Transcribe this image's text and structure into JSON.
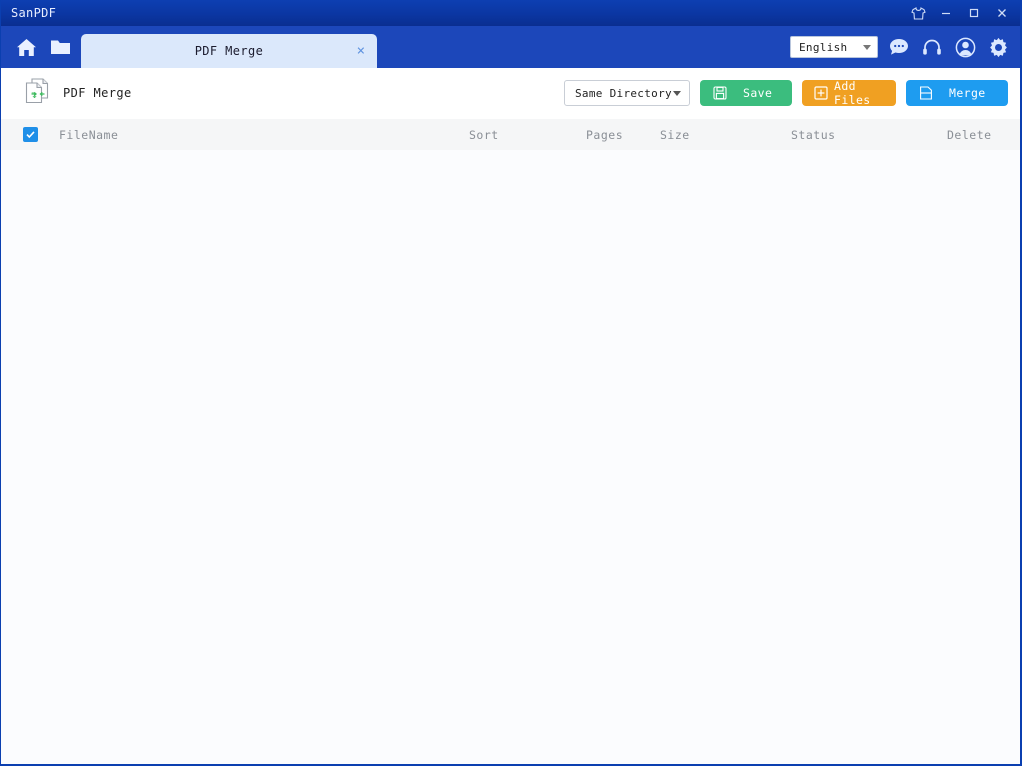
{
  "window": {
    "app_title": "SanPDF",
    "controls": [
      {
        "name": "skin-icon",
        "label": "Skin"
      },
      {
        "name": "minimize-button",
        "label": "Minimize"
      },
      {
        "name": "maximize-button",
        "label": "Maximize"
      },
      {
        "name": "close-button",
        "label": "Close"
      }
    ]
  },
  "tab_bar": {
    "nav_icons": [
      {
        "name": "home-icon",
        "label": "Home"
      },
      {
        "name": "open-folder-icon",
        "label": "Open Folder"
      }
    ],
    "tabs": [
      {
        "label": "PDF Merge",
        "close_label": "×",
        "active": true
      }
    ],
    "language": {
      "selected": "English",
      "options": [
        "English"
      ]
    },
    "tools": [
      {
        "name": "feedback-icon",
        "label": "Feedback"
      },
      {
        "name": "support-headset-icon",
        "label": "Support"
      },
      {
        "name": "user-account-icon",
        "label": "Account"
      },
      {
        "name": "settings-gear-icon",
        "label": "Settings"
      }
    ]
  },
  "action_bar": {
    "module_icon": "pdf-merge-icon",
    "module_title": "PDF Merge",
    "output_dir": {
      "selected": "Same Directory",
      "options": [
        "Same Directory"
      ]
    },
    "save_label": "Save",
    "add_files_label": "Add Files",
    "merge_label": "Merge"
  },
  "file_table": {
    "select_all_checked": true,
    "columns": {
      "filename": "FileName",
      "sort": "Sort",
      "pages": "Pages",
      "size": "Size",
      "status": "Status",
      "delete": "Delete"
    },
    "rows": []
  },
  "colors": {
    "title_bar": "#0b36a2",
    "toolbar": "#1c47ba",
    "tab_active": "#dbe8fb",
    "save_green": "#3bbd7e",
    "add_orange": "#f0a022",
    "merge_blue": "#1e9cf0",
    "checkbox_blue": "#1f8fe8",
    "header_row": "#f5f6f7",
    "body_bg": "#fbfcfe"
  }
}
